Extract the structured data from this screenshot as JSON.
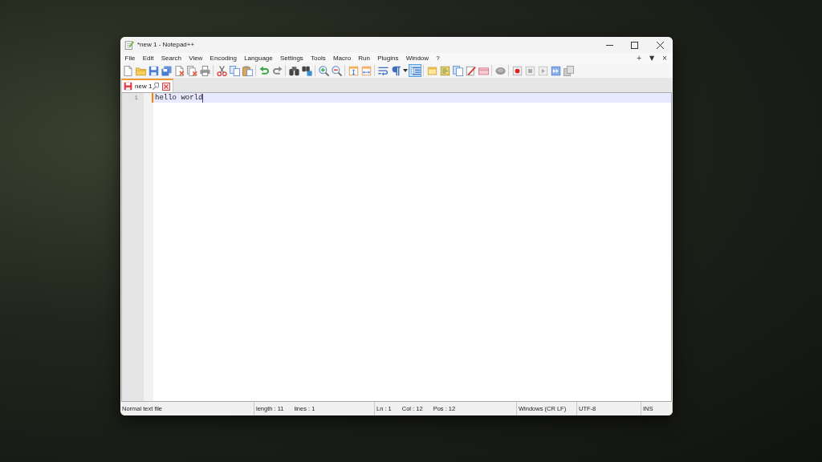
{
  "window": {
    "title": "*new 1 - Notepad++"
  },
  "menu": {
    "items": [
      "File",
      "Edit",
      "Search",
      "View",
      "Encoding",
      "Language",
      "Settings",
      "Tools",
      "Macro",
      "Run",
      "Plugins",
      "Window",
      "?"
    ],
    "right": [
      "+",
      "▼",
      "×"
    ]
  },
  "toolbar": {
    "toggles": [
      {
        "on": false
      },
      {
        "on": false
      },
      {
        "on": true
      }
    ]
  },
  "tabs": [
    {
      "label": "new 1",
      "selected": true,
      "modified": true
    }
  ],
  "editor": {
    "lines": [
      {
        "number": "1",
        "text": "hello world",
        "current": true,
        "changed": true
      }
    ]
  },
  "status_bar": {
    "sections": [
      [
        "Normal text file"
      ],
      [
        "length : 11",
        "lines : 1"
      ],
      [
        "Ln : 1",
        "Col : 12",
        "Pos : 12"
      ],
      [
        "Windows (CR LF)"
      ],
      [
        "UTF-8"
      ],
      [
        "INS"
      ]
    ]
  }
}
